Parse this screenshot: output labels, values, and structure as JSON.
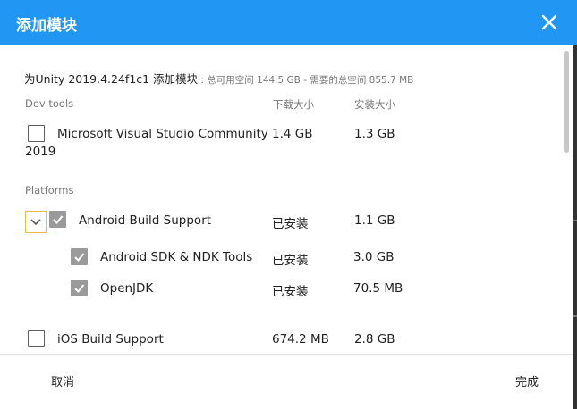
{
  "dialog": {
    "title": "添加模块",
    "close_icon": "close-icon",
    "accent_color": "#2196f3",
    "summary": {
      "prefix": "为Unity 2019.4.24f1c1 添加模块",
      "space": " : 总可用空间 144.5 GB - 需要的总空间 855.7 MB"
    }
  },
  "columns": {
    "download": "下载大小",
    "install": "安装大小"
  },
  "sections": {
    "dev_tools": {
      "label": "Dev tools",
      "items": [
        {
          "name_line1": "Microsoft Visual Studio Community",
          "name_line2": "2019",
          "download": "1.4 GB",
          "install": "1.3 GB",
          "checked": false
        }
      ]
    },
    "platforms": {
      "label": "Platforms",
      "items": [
        {
          "name": "Android Build Support",
          "download": "已安装",
          "install": "1.1 GB",
          "checked": true,
          "expanded": true
        },
        {
          "name": "Android SDK & NDK Tools",
          "download": "已安装",
          "install": "3.0 GB",
          "checked": true
        },
        {
          "name": "OpenJDK",
          "download": "已安装",
          "install": "70.5 MB",
          "checked": true
        },
        {
          "name": "iOS Build Support",
          "download": "674.2 MB",
          "install": "2.8 GB",
          "checked": false
        }
      ]
    }
  },
  "footer": {
    "cancel": "取消",
    "done": "完成"
  }
}
